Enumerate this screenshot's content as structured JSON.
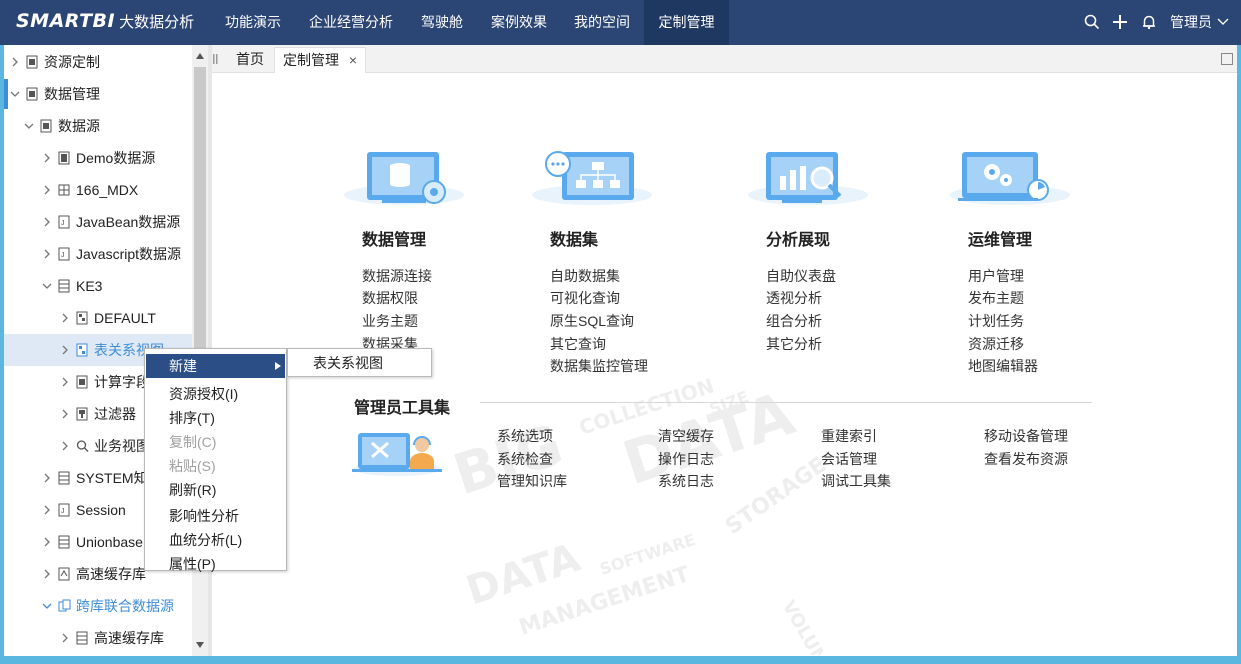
{
  "app": {
    "brand": "SMARTBI",
    "brand_suffix": "大数据分析",
    "nav": [
      "功能演示",
      "企业经营分析",
      "驾驶舱",
      "案例效果",
      "我的空间",
      "定制管理"
    ],
    "active_nav": "定制管理",
    "user": "管理员"
  },
  "tree": [
    "资源定制",
    "数据管理",
    "数据源",
    "Demo数据源",
    "166_MDX",
    "JavaBean数据源",
    "Javascript数据源",
    "KE3",
    "DEFAULT",
    "表关系视图",
    "计算字段",
    "过滤器",
    "业务视图",
    "SYSTEM知识库",
    "Session",
    "Unionbase",
    "高速缓存库",
    "跨库联合数据源",
    "高速缓存库"
  ],
  "tabs": {
    "home": "首页",
    "current": "定制管理",
    "close": "×"
  },
  "modules": [
    {
      "title": "数据管理",
      "links": [
        "数据源连接",
        "数据权限",
        "业务主题",
        "数据采集"
      ]
    },
    {
      "title": "数据集",
      "links": [
        "自助数据集",
        "可视化查询",
        "原生SQL查询",
        "其它查询",
        "数据集监控管理"
      ]
    },
    {
      "title": "分析展现",
      "links": [
        "自助仪表盘",
        "透视分析",
        "组合分析",
        "其它分析"
      ]
    },
    {
      "title": "运维管理",
      "links": [
        "用户管理",
        "发布主题",
        "计划任务",
        "资源迁移",
        "地图编辑器"
      ]
    }
  ],
  "admin": {
    "title": "管理员工具集",
    "links": [
      "系统选项",
      "系统检查",
      "管理知识库",
      "清空缓存",
      "操作日志",
      "系统日志",
      "重建索引",
      "会话管理",
      "调试工具集",
      "移动设备管理",
      "查看发布资源"
    ]
  },
  "context_menu": {
    "items": [
      "新建",
      "资源授权(I)",
      "排序(T)",
      "复制(C)",
      "粘贴(S)",
      "刷新(R)",
      "影响性分析",
      "血统分析(L)",
      "属性(P)"
    ],
    "highlighted": "新建",
    "disabled": [
      "复制(C)",
      "粘贴(S)"
    ],
    "submenu": [
      "表关系视图"
    ]
  },
  "colors": {
    "topbar": "#2b4574",
    "accent": "#3f8dd6",
    "menu_highlight": "#2b4e86",
    "frame": "#5ab8e0"
  }
}
